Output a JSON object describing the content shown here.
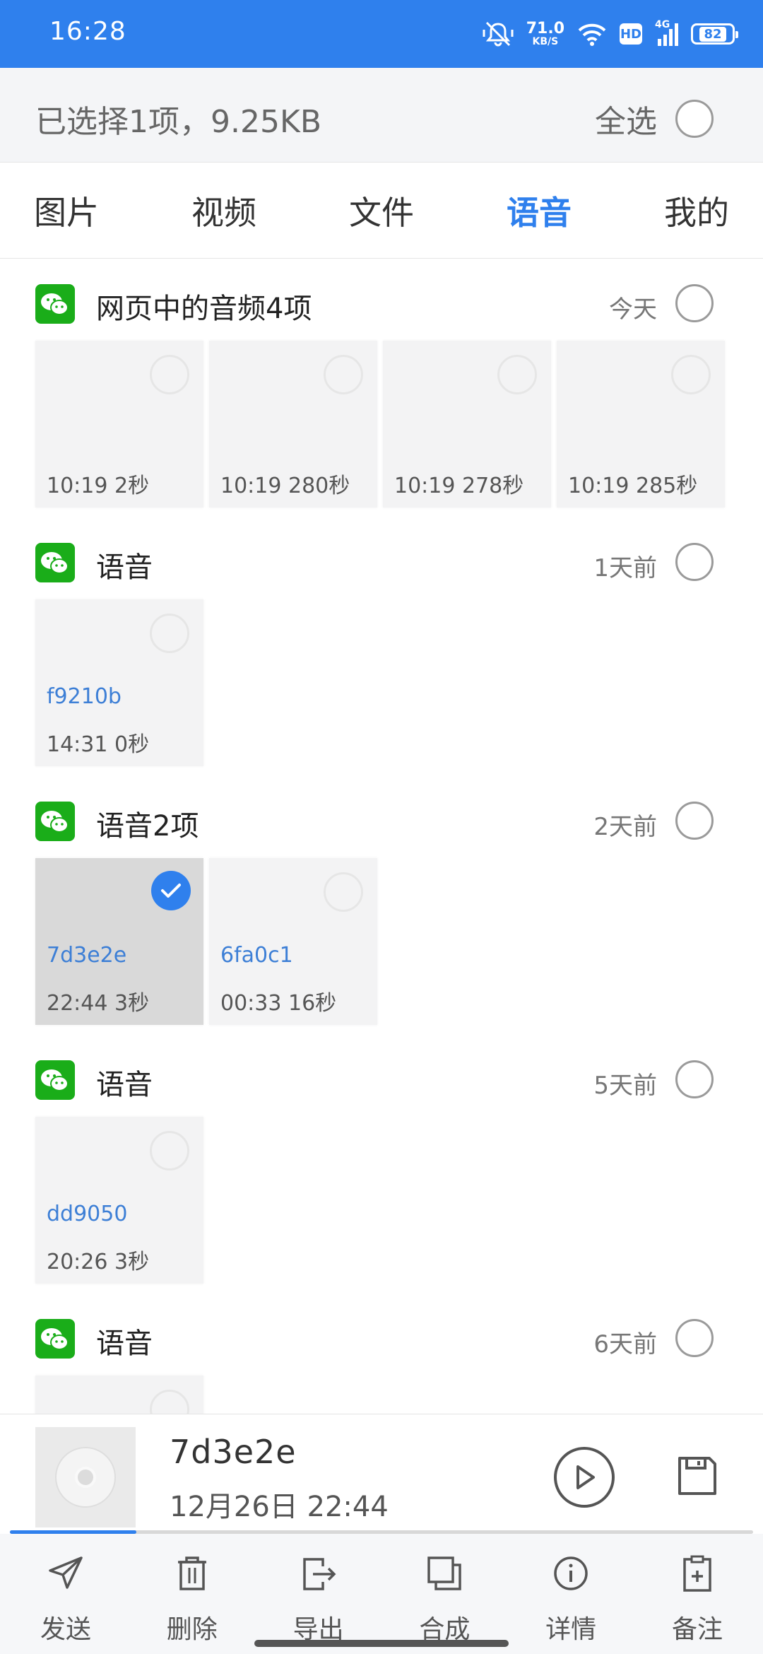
{
  "status_bar": {
    "time": "16:28",
    "net_speed_value": "71.0",
    "net_speed_unit": "KB/S",
    "hd_label": "HD",
    "network_label": "4G",
    "battery_level": "82",
    "icons": [
      "mute-icon",
      "wifi-icon",
      "signal-icon",
      "battery-icon"
    ]
  },
  "selection": {
    "summary": "已选择1项，9.25KB",
    "select_all_label": "全选"
  },
  "tabs": [
    {
      "label": "图片",
      "active": false
    },
    {
      "label": "视频",
      "active": false
    },
    {
      "label": "文件",
      "active": false
    },
    {
      "label": "语音",
      "active": true
    },
    {
      "label": "我的",
      "active": false
    }
  ],
  "groups": [
    {
      "title": "网页中的音频4项",
      "time": "今天",
      "items": [
        {
          "name": "",
          "meta": "10:19  2秒",
          "selected": false
        },
        {
          "name": "",
          "meta": "10:19  280秒",
          "selected": false
        },
        {
          "name": "",
          "meta": "10:19  278秒",
          "selected": false
        },
        {
          "name": "",
          "meta": "10:19  285秒",
          "selected": false
        }
      ]
    },
    {
      "title": "语音",
      "time": "1天前",
      "items": [
        {
          "name": "f9210b",
          "meta": "14:31  0秒",
          "selected": false
        }
      ]
    },
    {
      "title": "语音2项",
      "time": "2天前",
      "items": [
        {
          "name": "7d3e2e",
          "meta": "22:44  3秒",
          "selected": true
        },
        {
          "name": "6fa0c1",
          "meta": "00:33  16秒",
          "selected": false
        }
      ]
    },
    {
      "title": "语音",
      "time": "5天前",
      "items": [
        {
          "name": "dd9050",
          "meta": "20:26  3秒",
          "selected": false
        }
      ]
    },
    {
      "title": "语音",
      "time": "6天前",
      "items": [
        {
          "name": "",
          "meta": "",
          "selected": false
        }
      ]
    }
  ],
  "player": {
    "name": "7d3e2e",
    "date": "12月26日  22:44",
    "progress": 0.17
  },
  "actions": [
    {
      "label": "发送",
      "icon": "send-icon"
    },
    {
      "label": "删除",
      "icon": "trash-icon"
    },
    {
      "label": "导出",
      "icon": "export-icon"
    },
    {
      "label": "合成",
      "icon": "merge-icon"
    },
    {
      "label": "详情",
      "icon": "info-icon"
    },
    {
      "label": "备注",
      "icon": "note-icon"
    }
  ],
  "colors": {
    "accent": "#2f80ed",
    "wechat_green": "#1aad19",
    "item_name": "#3d7fd6"
  }
}
